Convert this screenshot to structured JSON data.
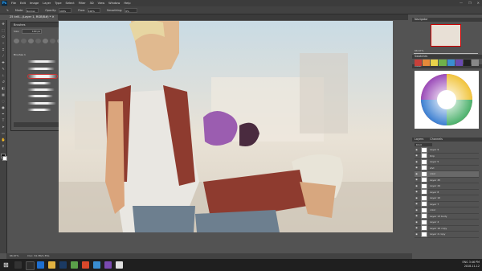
{
  "app": {
    "logo": "Ps",
    "document_tab": "25 krill...(Layer 1, RGB/8#) *  ✕"
  },
  "menu": [
    "File",
    "Edit",
    "Image",
    "Layer",
    "Type",
    "Select",
    "Filter",
    "3D",
    "View",
    "Window",
    "Help"
  ],
  "window_controls": [
    "—",
    "❐",
    "✕"
  ],
  "options": {
    "mode_label": "Mode:",
    "mode_value": "Normal",
    "opacity_label": "Opacity:",
    "opacity_value": "100%",
    "flow_label": "Flow:",
    "flow_value": "100%",
    "smoothing_label": "Smoothing:",
    "smoothing_value": "0%"
  },
  "brushes_panel": {
    "title": "Brushes",
    "size_label": "Size:",
    "size_value": "100 px",
    "group_label": "Brushes 1"
  },
  "right": {
    "navigator": "Navigator",
    "zoom": "66.67%",
    "swatches": "Swatches",
    "color": "Color",
    "layers_title": "Layers",
    "channels": "Channels",
    "kind_label": "Kind"
  },
  "layers": [
    {
      "name": "Layer 9"
    },
    {
      "name": "tmp"
    },
    {
      "name": "Layer 5"
    },
    {
      "name": "shd"
    },
    {
      "name": "color"
    },
    {
      "name": "Layer 45"
    },
    {
      "name": "Layer 44"
    },
    {
      "name": "Layer 8"
    },
    {
      "name": "Layer 10"
    },
    {
      "name": "Layer 7"
    },
    {
      "name": "color"
    },
    {
      "name": "Layer 13 body"
    },
    {
      "name": "Layer 4"
    },
    {
      "name": "Layer 10 copy"
    },
    {
      "name": "Layer 4 copy"
    }
  ],
  "status": {
    "zoom": "66.67%",
    "doc": "Doc: 34.3M/1.35G"
  },
  "taskbar": {
    "time": "3:46 PM",
    "date": "2018-11-12",
    "lang": "ENG"
  }
}
